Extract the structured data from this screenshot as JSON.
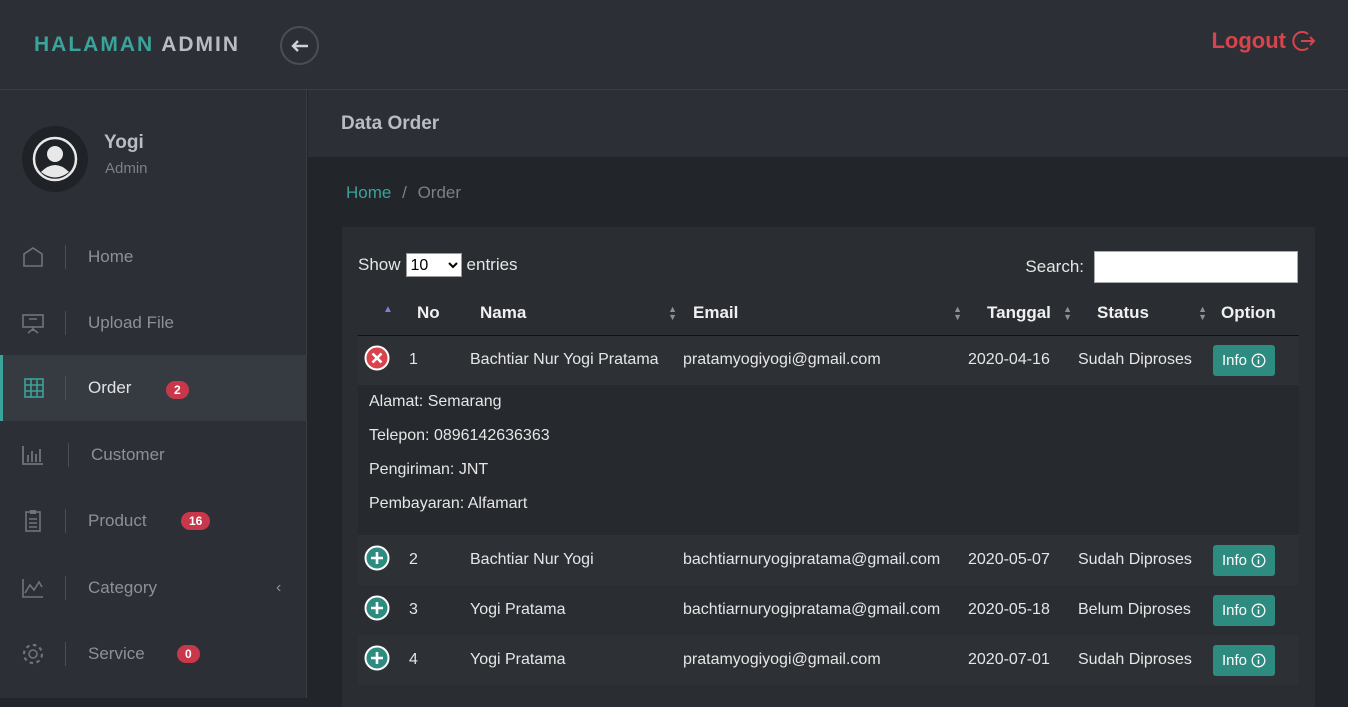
{
  "header": {
    "brand_part1": "HALAMAN",
    "brand_part2": "ADMIN",
    "logout_label": "Logout"
  },
  "profile": {
    "name": "Yogi",
    "role": "Admin"
  },
  "sidebar": {
    "items": [
      {
        "label": "Home",
        "icon": "home-icon",
        "badge": ""
      },
      {
        "label": "Upload File",
        "icon": "presentation-icon",
        "badge": ""
      },
      {
        "label": "Order",
        "icon": "grid-icon",
        "badge": "2"
      },
      {
        "label": "Customer",
        "icon": "bar-chart-icon",
        "badge": ""
      },
      {
        "label": "Product",
        "icon": "clipboard-icon",
        "badge": "16"
      },
      {
        "label": "Category",
        "icon": "line-chart-icon",
        "badge": ""
      },
      {
        "label": "Service",
        "icon": "gear-icon",
        "badge": "0"
      }
    ]
  },
  "main": {
    "title": "Data Order",
    "breadcrumb": {
      "home": "Home",
      "separator": "/",
      "current": "Order"
    }
  },
  "table": {
    "show_label": "Show",
    "entries_value": "10",
    "entries_label": "entries",
    "search_label": "Search:",
    "search_value": "",
    "columns": [
      "No",
      "Nama",
      "Email",
      "Tanggal",
      "Status",
      "Option"
    ],
    "rows": [
      {
        "no": "1",
        "nama": "Bachtiar Nur Yogi Pratama",
        "email": "pratamyogiyogi@gmail.com",
        "tanggal": "2020-04-16",
        "status": "Sudah Diproses",
        "option": "Info"
      },
      {
        "no": "2",
        "nama": "Bachtiar Nur Yogi",
        "email": "bachtiarnuryogipratama@gmail.com",
        "tanggal": "2020-05-07",
        "status": "Sudah Diproses",
        "option": "Info"
      },
      {
        "no": "3",
        "nama": "Yogi Pratama",
        "email": "bachtiarnuryogipratama@gmail.com",
        "tanggal": "2020-05-18",
        "status": "Belum Diproses",
        "option": "Info"
      },
      {
        "no": "4",
        "nama": "Yogi Pratama",
        "email": "pratamyogiyogi@gmail.com",
        "tanggal": "2020-07-01",
        "status": "Sudah Diproses",
        "option": "Info"
      }
    ],
    "expanded_detail": {
      "alamat": "Alamat: Semarang",
      "telepon": "Telepon: 0896142636363",
      "pengiriman": "Pengiriman: JNT",
      "pembayaran": "Pembayaran: Alfamart"
    }
  },
  "colors": {
    "accent": "#3aa39a",
    "logout": "#d9434b",
    "badge": "#c9384a",
    "info_button": "#2e8b80",
    "collapse_control": "#d9434b"
  }
}
